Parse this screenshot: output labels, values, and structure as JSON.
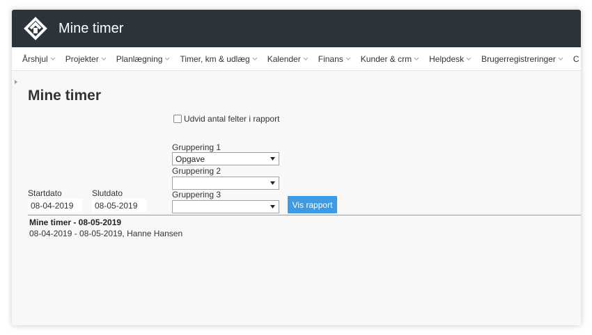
{
  "header": {
    "title": "Mine timer",
    "logo": "logo-icon"
  },
  "nav": {
    "items": [
      {
        "label": "Årshjul"
      },
      {
        "label": "Projekter"
      },
      {
        "label": "Planlægning"
      },
      {
        "label": "Timer, km & udlæg"
      },
      {
        "label": "Kalender"
      },
      {
        "label": "Finans"
      },
      {
        "label": "Kunder & crm"
      },
      {
        "label": "Helpdesk"
      },
      {
        "label": "Brugerregistreringer"
      },
      {
        "label": "C"
      }
    ]
  },
  "page": {
    "title": "Mine timer",
    "expand_label": "Udvid antal felter i rapport",
    "start_label": "Startdato",
    "start_value": "08-04-2019",
    "end_label": "Slutdato",
    "end_value": "08-05-2019",
    "group1_label": "Gruppering 1",
    "group1_value": "Opgave",
    "group2_label": "Gruppering 2",
    "group2_value": "",
    "group3_label": "Gruppering 3",
    "group3_value": "",
    "button_label": "Vis rapport"
  },
  "report": {
    "title": "Mine timer - 08-05-2019",
    "subtitle": "08-04-2019 - 08-05-2019, Hanne Hansen"
  },
  "colors": {
    "header_bg": "#2b343a",
    "accent": "#3c9be4"
  }
}
